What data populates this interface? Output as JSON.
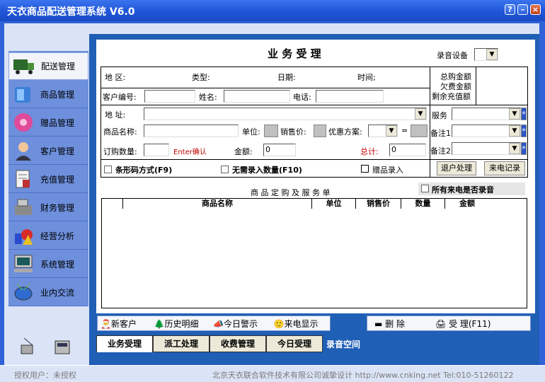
{
  "app": {
    "title": "天衣商品配送管理系统 V6.0",
    "help": "?",
    "min": "–",
    "close": "×"
  },
  "sidebar": {
    "items": [
      {
        "label": "配送管理",
        "icon": "truck-icon"
      },
      {
        "label": "商品管理",
        "icon": "box-icon"
      },
      {
        "label": "赠品管理",
        "icon": "gift-icon"
      },
      {
        "label": "客户管理",
        "icon": "person-icon"
      },
      {
        "label": "充值管理",
        "icon": "notepad-icon"
      },
      {
        "label": "财务管理",
        "icon": "cash-register-icon"
      },
      {
        "label": "经营分析",
        "icon": "chart-shapes-icon"
      },
      {
        "label": "系统管理",
        "icon": "computer-icon"
      },
      {
        "label": "业内交流",
        "icon": "drum-icon"
      }
    ]
  },
  "form": {
    "title": "业 务 受 理",
    "recording_device_label": "录音设备",
    "area_label": "地    区:",
    "type_label": "类型:",
    "date_label": "日期:",
    "time_label": "时间;",
    "summary": [
      "总购金额",
      "欠费金额",
      "剩余充值额"
    ],
    "customer_id_label": "客户编号:",
    "name_label": "姓名:",
    "phone_label": "电话:",
    "address_label": "地    址:",
    "service_label": "服务",
    "product_label": "商品名称:",
    "unit_label": "单位:",
    "price_label": "销售价:",
    "discount_label": "优惠方案:",
    "equals": "=",
    "note1_label": "备注1",
    "qty_label": "订购数量:",
    "enter_hint": "Enter确认",
    "amount_label": "金额:",
    "amount_value": "0",
    "total_label": "总计:",
    "total_value": "0",
    "note2_label": "备注2",
    "barcode_label": "条形码方式(F9)",
    "noqty_label": "无需录入数量(F10)",
    "gift_label": "赠品录入",
    "refund_button": "退户处理",
    "calllog_button": "来电记录",
    "list_title": "商 品 定 购 及 服 务 单",
    "record_all_label": "所有来电是否录音",
    "columns": [
      "商品名称",
      "单位",
      "销售价",
      "数量",
      "金额"
    ]
  },
  "toolbar": {
    "items": [
      "新客户",
      "历史明细",
      "今日警示",
      "来电显示"
    ],
    "delete": "删        除",
    "accept": "受   理(F11)"
  },
  "tabs": [
    "业务受理",
    "派工处理",
    "收费管理",
    "今日受理",
    "录音空间"
  ],
  "status": {
    "user": "授权用户：未授权",
    "company": "北京天衣联合软件技术有限公司诚挚设计 http://www.cnking.net Tel:010-51260122"
  },
  "colors": {
    "title_bar": "#2f62d8",
    "content_bg": "#1f5fb5",
    "sidebar": "#6d8fdc",
    "red_label": "#c00000"
  }
}
